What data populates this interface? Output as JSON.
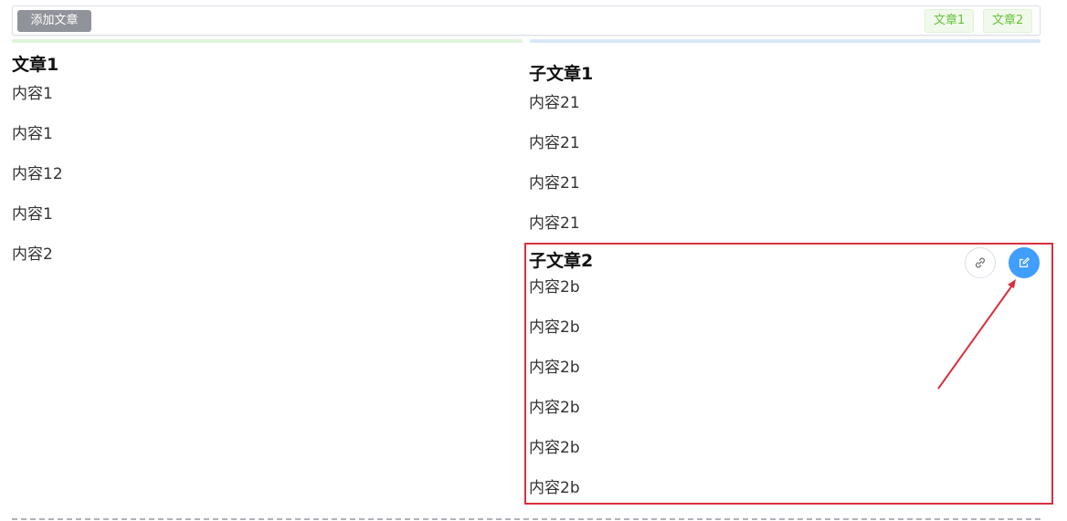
{
  "toolbar": {
    "add_article_label": "添加文章",
    "tags": [
      "文章1",
      "文章2"
    ]
  },
  "left_column": {
    "title": "文章1",
    "paragraphs": [
      "内容1",
      "内容1",
      "内容12",
      "内容1",
      "内容2"
    ]
  },
  "right_column": {
    "sub_article_1": {
      "title": "子文章1",
      "paragraphs": [
        "内容21",
        "内容21",
        "内容21",
        "内容21"
      ]
    },
    "sub_article_2": {
      "title": "子文章2",
      "paragraphs": [
        "内容2b",
        "内容2b",
        "内容2b",
        "内容2b",
        "内容2b",
        "内容2b"
      ]
    }
  },
  "actions": {
    "link_icon": "link-icon",
    "edit_icon": "edit-icon"
  },
  "colors": {
    "tag_bg": "#f0f9eb",
    "tag_text": "#67c23a",
    "edit_button": "#409eff",
    "highlight_border": "#d9303c"
  }
}
